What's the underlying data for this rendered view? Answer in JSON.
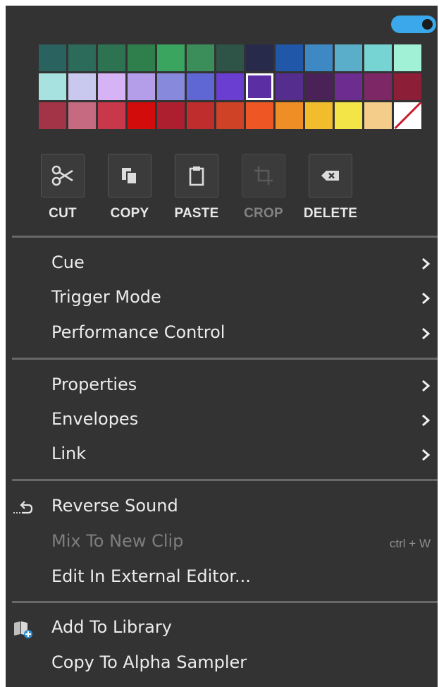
{
  "toggle": {
    "state": "on",
    "color": "#3aa8ea"
  },
  "palette": {
    "selected_index": 20,
    "rows": [
      [
        "#2a625f",
        "#2c6a5a",
        "#2d7351",
        "#2f7f4c",
        "#3aa55e",
        "#3b8e5a",
        "#2e5447",
        "#272a4a",
        "#2157a8",
        "#3e88c3",
        "#5aaec9",
        "#76d5d2",
        "#a1f1d6"
      ],
      [
        "#a7e1e0",
        "#c9c9ef",
        "#d5b3f4",
        "#b49ee9",
        "#8689dc",
        "#5f67d4",
        "#6b3ed2",
        "#5b2ea4",
        "#552d8e",
        "#4a2257",
        "#6d2c8f",
        "#7e2767",
        "#8c1e37"
      ],
      [
        "#a33346",
        "#c66a81",
        "#c8374a",
        "#d20b0b",
        "#ad1f2e",
        "#bf2d2c",
        "#d04226",
        "#ee5723",
        "#ee8e24",
        "#f1bd2c",
        "#f3e448",
        "#f4cd8a",
        "none"
      ]
    ]
  },
  "tools": [
    {
      "label": "CUT",
      "icon": "scissors-icon",
      "enabled": true
    },
    {
      "label": "COPY",
      "icon": "copy-icon",
      "enabled": true
    },
    {
      "label": "PASTE",
      "icon": "clipboard-icon",
      "enabled": true
    },
    {
      "label": "CROP",
      "icon": "crop-icon",
      "enabled": false
    },
    {
      "label": "DELETE",
      "icon": "backspace-icon",
      "enabled": true
    }
  ],
  "menu_groups": [
    [
      {
        "label": "Cue",
        "submenu": true
      },
      {
        "label": "Trigger Mode",
        "submenu": true
      },
      {
        "label": "Performance Control",
        "submenu": true
      }
    ],
    [
      {
        "label": "Properties",
        "submenu": true
      },
      {
        "label": "Envelopes",
        "submenu": true
      },
      {
        "label": "Link",
        "submenu": true
      }
    ],
    [
      {
        "label": "Reverse Sound",
        "icon": "reverse-icon"
      },
      {
        "label": "Mix To New Clip",
        "enabled": false,
        "shortcut": "ctrl + W"
      },
      {
        "label": "Edit In External Editor..."
      }
    ],
    [
      {
        "label": "Add To Library",
        "icon": "library-add-icon"
      },
      {
        "label": "Copy To Alpha Sampler"
      }
    ]
  ]
}
